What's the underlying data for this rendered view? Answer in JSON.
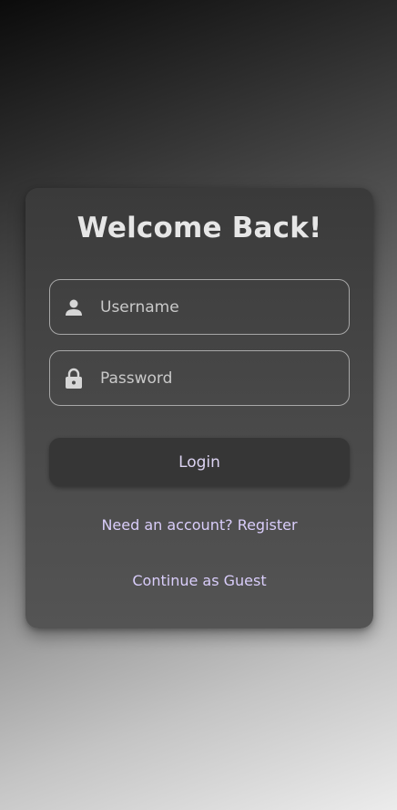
{
  "login_card": {
    "title": "Welcome Back!",
    "username": {
      "placeholder": "Username",
      "value": "",
      "icon": "person-icon"
    },
    "password": {
      "placeholder": "Password",
      "value": "",
      "icon": "lock-icon"
    },
    "login_label": "Login",
    "register_link": "Need an account? Register",
    "guest_link": "Continue as Guest"
  },
  "colors": {
    "card_background": "#474747",
    "button_background": "#363636",
    "link_text": "#d9cdfa",
    "field_border": "#a7a7a7"
  }
}
